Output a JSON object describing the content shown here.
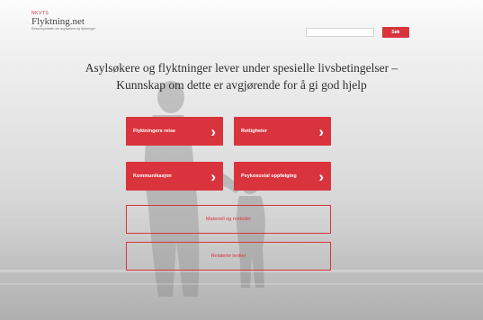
{
  "logo": {
    "mark": "NKVTS",
    "title": "Flyktning.net",
    "tagline": "Ressursportalen om asylsøkere og flyktninger"
  },
  "search": {
    "placeholder": "",
    "button_label": "Søk"
  },
  "headline": {
    "line1": "Asylsøkere og flyktninger lever under spesielle livsbetingelser –",
    "line2": "Kunnskap om dette er avgjørende for å gi god hjelp"
  },
  "tiles": [
    {
      "label": "Flyktningers reise",
      "arrow": "›"
    },
    {
      "label": "Rettigheter",
      "arrow": "›"
    },
    {
      "label": "Kommunikasjon",
      "arrow": "›"
    },
    {
      "label": "Psykososial oppfølging",
      "arrow": "›"
    }
  ],
  "outline_buttons": [
    {
      "label": "Materiell og metoder"
    },
    {
      "label": "Relaterte lenker"
    }
  ],
  "colors": {
    "accent": "#d9343d",
    "headline_text": "#2f2f2f"
  }
}
